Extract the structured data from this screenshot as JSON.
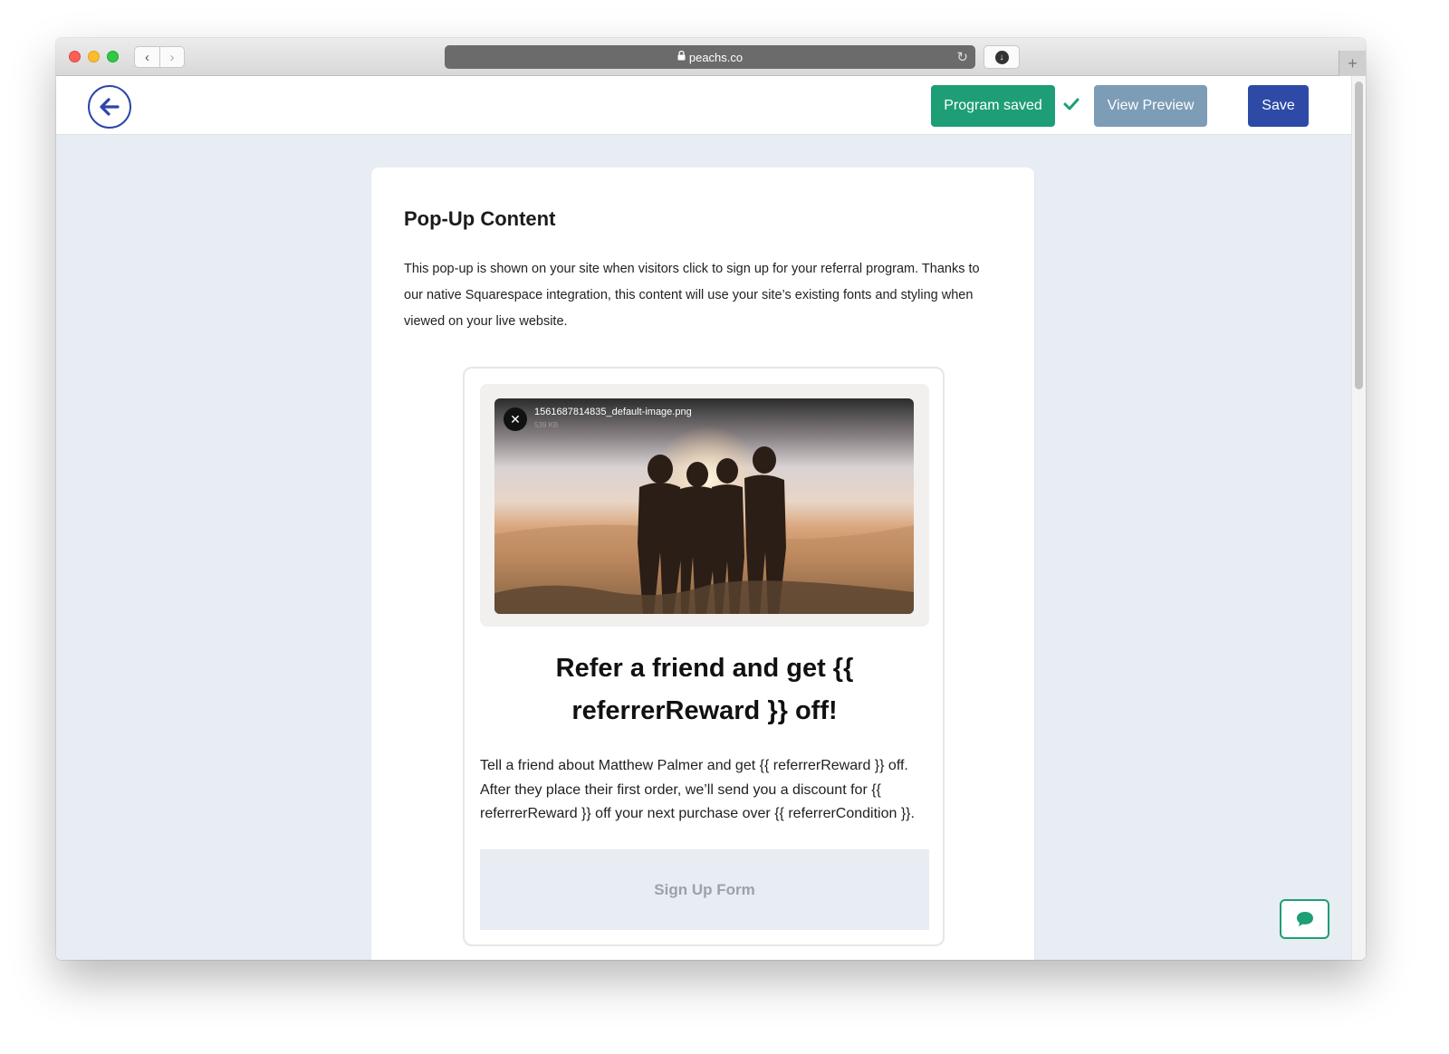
{
  "browser": {
    "url": "peachs.co",
    "back_glyph": "‹",
    "forward_glyph": "›",
    "reload_glyph": "↻",
    "download_glyph": "↓",
    "new_tab_glyph": "+"
  },
  "header": {
    "program_saved_label": "Program saved",
    "view_preview_label": "View Preview",
    "save_label": "Save"
  },
  "card": {
    "title": "Pop-Up Content",
    "description": "This pop-up is shown on your site when visitors click to sign up for your referral program. Thanks to our native Squarespace integration, this content will use your site’s existing fonts and styling when viewed on your live website."
  },
  "popup": {
    "image": {
      "filename": "1561687814835_default-image.png",
      "filesize": "539 KB",
      "close_glyph": "✕"
    },
    "heading": "Refer a friend and get {{ referrerReward }} off!",
    "body": "Tell a friend about Matthew Palmer and get {{ referrerReward }} off. After they place their first order, we’ll send you a discount for {{ referrerReward }} off your next purchase over {{ referrerCondition }}.",
    "signup_label": "Sign Up Form"
  },
  "icons": {
    "back": "arrow-left-icon",
    "check": "checkmark-icon",
    "chat": "chat-bubble-icon",
    "lock": "lock-icon"
  },
  "colors": {
    "brand_blue": "#2d4aa6",
    "success_green": "#1e9e76",
    "preview_blue": "#7d9cb6",
    "content_bg": "#e8ecf3"
  }
}
